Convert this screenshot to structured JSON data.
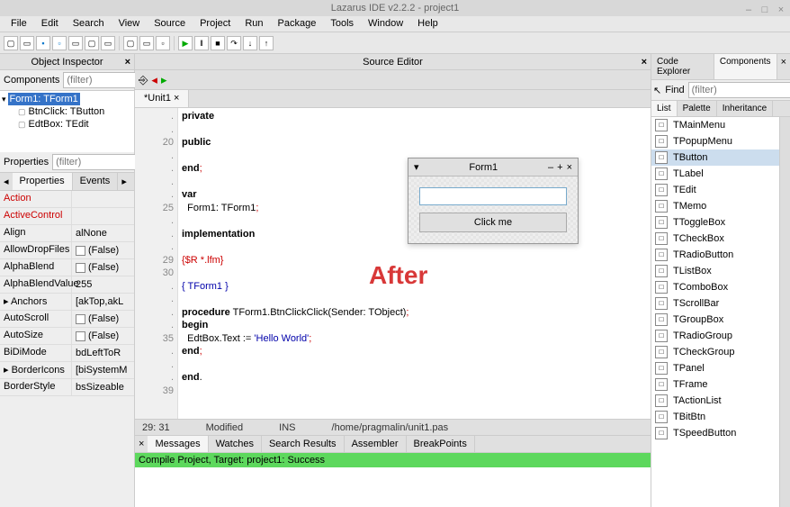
{
  "app_title": "Lazarus IDE v2.2.2 - project1",
  "menu": [
    "File",
    "Edit",
    "Search",
    "View",
    "Source",
    "Project",
    "Run",
    "Package",
    "Tools",
    "Window",
    "Help"
  ],
  "object_inspector": {
    "title": "Object Inspector",
    "components_label": "Components",
    "filter_placeholder": "(filter)",
    "tree_selected": "Form1: TForm1",
    "tree_items": [
      "BtnClick: TButton",
      "EdtBox: TEdit"
    ],
    "properties_label": "Properties",
    "tabs": [
      "Properties",
      "Events"
    ],
    "props": [
      {
        "k": "Action",
        "v": "",
        "red": true
      },
      {
        "k": "ActiveControl",
        "v": "",
        "red": true
      },
      {
        "k": "Align",
        "v": "alNone"
      },
      {
        "k": "AllowDropFiles",
        "v": "(False)",
        "cb": true
      },
      {
        "k": "AlphaBlend",
        "v": "(False)",
        "cb": true
      },
      {
        "k": "AlphaBlendValue",
        "v": "255"
      },
      {
        "k": "Anchors",
        "v": "[akTop,akL",
        "exp": true
      },
      {
        "k": "AutoScroll",
        "v": "(False)",
        "cb": true
      },
      {
        "k": "AutoSize",
        "v": "(False)",
        "cb": true
      },
      {
        "k": "BiDiMode",
        "v": "bdLeftToR"
      },
      {
        "k": "BorderIcons",
        "v": "[biSystemM",
        "exp": true
      },
      {
        "k": "BorderStyle",
        "v": "bsSizeable"
      }
    ]
  },
  "source_editor": {
    "title": "Source Editor",
    "tab": "*Unit1",
    "lines": [
      {
        "n": "",
        "t": "private"
      },
      {
        "n": "",
        "t": ""
      },
      {
        "n": "20",
        "t": "public"
      },
      {
        "n": "",
        "t": ""
      },
      {
        "n": "",
        "t": "end;"
      },
      {
        "n": "",
        "t": ""
      },
      {
        "n": "",
        "t": "var"
      },
      {
        "n": "25",
        "t": "  Form1: TForm1;"
      },
      {
        "n": "",
        "t": ""
      },
      {
        "n": "",
        "t": "implementation"
      },
      {
        "n": "",
        "t": ""
      },
      {
        "n": "29",
        "t": "{$R *.lfm}"
      },
      {
        "n": "30",
        "t": ""
      },
      {
        "n": "",
        "t": "{ TForm1 }"
      },
      {
        "n": "",
        "t": ""
      },
      {
        "n": "",
        "t": "procedure TForm1.BtnClickClick(Sender: TObject);"
      },
      {
        "n": "",
        "t": "begin"
      },
      {
        "n": "35",
        "t": "  EdtBox.Text := 'Hello World';"
      },
      {
        "n": "",
        "t": "end;"
      },
      {
        "n": "",
        "t": ""
      },
      {
        "n": "",
        "t": "end."
      },
      {
        "n": "39",
        "t": ""
      }
    ],
    "status": {
      "pos": "29: 31",
      "mod": "Modified",
      "ins": "INS",
      "path": "/home/pragmalin/unit1.pas"
    }
  },
  "after_label": "After",
  "form_win": {
    "title": "Form1",
    "button": "Click me"
  },
  "messages": {
    "tabs": [
      "Messages",
      "Watches",
      "Search Results",
      "Assembler",
      "BreakPoints"
    ],
    "line": "Compile Project, Target: project1: Success"
  },
  "right_panel": {
    "top_tabs": [
      "Code Explorer",
      "Components"
    ],
    "find_label": "Find",
    "find_placeholder": "(filter)",
    "list_tabs": [
      "List",
      "Palette",
      "Inheritance"
    ],
    "items": [
      "TMainMenu",
      "TPopupMenu",
      "TButton",
      "TLabel",
      "TEdit",
      "TMemo",
      "TToggleBox",
      "TCheckBox",
      "TRadioButton",
      "TListBox",
      "TComboBox",
      "TScrollBar",
      "TGroupBox",
      "TRadioGroup",
      "TCheckGroup",
      "TPanel",
      "TFrame",
      "TActionList",
      "TBitBtn",
      "TSpeedButton"
    ],
    "selected": "TButton"
  }
}
